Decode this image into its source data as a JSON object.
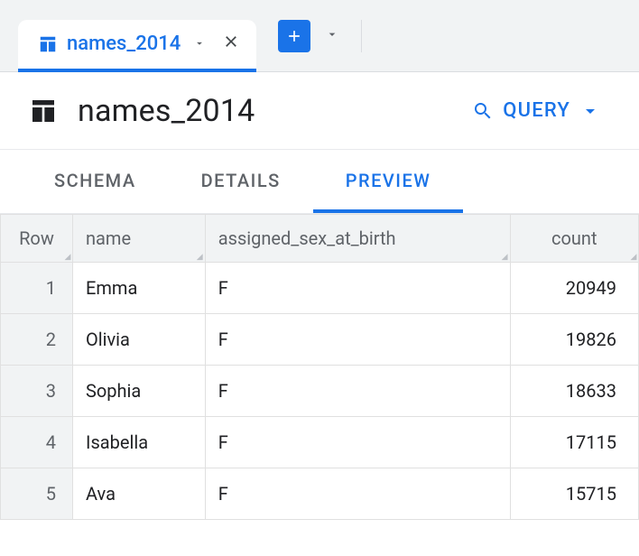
{
  "tab": {
    "label": "names_2014"
  },
  "header": {
    "title": "names_2014"
  },
  "query_button": {
    "label": "QUERY"
  },
  "subtabs": {
    "schema": "SCHEMA",
    "details": "DETAILS",
    "preview": "PREVIEW"
  },
  "columns": {
    "row": "Row",
    "name": "name",
    "assigned_sex_at_birth": "assigned_sex_at_birth",
    "count": "count"
  },
  "rows": [
    {
      "n": "1",
      "name": "Emma",
      "sex": "F",
      "count": "20949"
    },
    {
      "n": "2",
      "name": "Olivia",
      "sex": "F",
      "count": "19826"
    },
    {
      "n": "3",
      "name": "Sophia",
      "sex": "F",
      "count": "18633"
    },
    {
      "n": "4",
      "name": "Isabella",
      "sex": "F",
      "count": "17115"
    },
    {
      "n": "5",
      "name": "Ava",
      "sex": "F",
      "count": "15715"
    }
  ]
}
